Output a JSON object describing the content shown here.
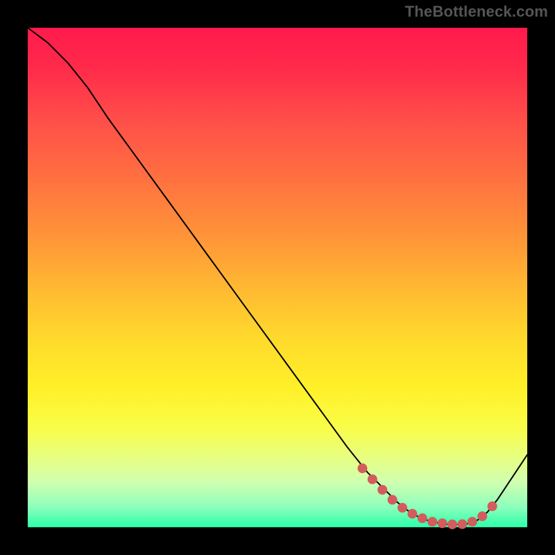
{
  "attribution": "TheBottleneck.com",
  "chart_data": {
    "type": "line",
    "title": "",
    "xlabel": "",
    "ylabel": "",
    "xlim": [
      0,
      100
    ],
    "ylim": [
      0,
      100
    ],
    "series": [
      {
        "name": "bottleneck-curve",
        "x": [
          0,
          4,
          8,
          12,
          16,
          20,
          24,
          28,
          32,
          36,
          40,
          44,
          48,
          52,
          56,
          60,
          64,
          68,
          72,
          74,
          76,
          78,
          80,
          82,
          84,
          86,
          88,
          90,
          92,
          94,
          96,
          98,
          100
        ],
        "y": [
          100,
          97,
          93,
          88,
          82,
          76.5,
          71,
          65.5,
          60,
          54.5,
          49,
          43.5,
          38,
          32.5,
          27,
          21.5,
          16,
          11,
          7,
          5,
          3.4,
          2.2,
          1.4,
          0.9,
          0.6,
          0.55,
          0.7,
          1.4,
          3.0,
          5.5,
          8.5,
          11.5,
          14.5
        ]
      }
    ],
    "markers": {
      "name": "highlight-dots",
      "color": "#d35c5c",
      "x": [
        67,
        69,
        71,
        73,
        75,
        77,
        79,
        81,
        83,
        85,
        87,
        89,
        91,
        93
      ],
      "y": [
        11.8,
        9.6,
        7.5,
        5.5,
        3.9,
        2.7,
        1.8,
        1.1,
        0.8,
        0.58,
        0.62,
        1.1,
        2.2,
        4.2
      ]
    },
    "background_gradient": {
      "top": "#ff1a4d",
      "mid": "#fff028",
      "bottom": "#2bffa8"
    }
  }
}
